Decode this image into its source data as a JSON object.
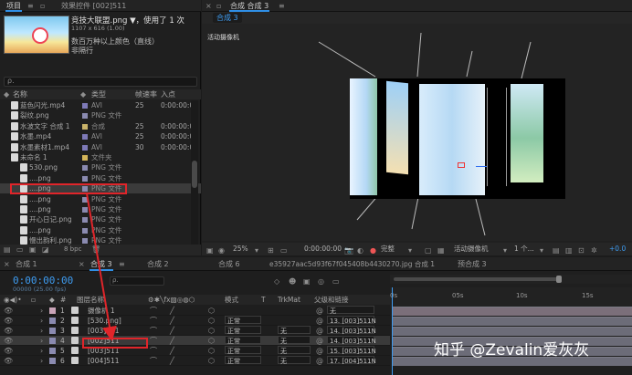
{
  "project_panel": {
    "tabs": [
      {
        "label": "项目"
      },
      {
        "label": "效果控件 [002]511"
      }
    ],
    "file": {
      "name": "竞技大联盟.png ▼",
      "used": "，使用了 1 次",
      "dims": "1107 x 616 (1.00)",
      "depth": "数百万种以上颜色（直线）",
      "interlace": "非隔行"
    },
    "thumb_text": "",
    "search_placeholder": "ρ.",
    "columns": {
      "name": "名称",
      "type": "类型",
      "fps": "帧速率",
      "in": "入点"
    },
    "rows": [
      {
        "name": "蓝色闪光.mp4",
        "type": "AVI",
        "fps": "25",
        "in": "0:00:00:0",
        "color": "#7e7ab8"
      },
      {
        "name": "裂纹.png",
        "type": "PNG 文件",
        "fps": "",
        "in": "",
        "color": "#8a8ab0"
      },
      {
        "name": "水波文字 合成 1",
        "type": "合成",
        "fps": "25",
        "in": "0:00:00:0",
        "color": "#c9b36a"
      },
      {
        "name": "水墨.mp4",
        "type": "AVI",
        "fps": "25",
        "in": "0:00:00:0",
        "color": "#7e7ab8"
      },
      {
        "name": "水墨素材1.mp4",
        "type": "AVI",
        "fps": "30",
        "in": "0:00:00:0",
        "color": "#7e7ab8"
      },
      {
        "name": "未命名 1",
        "type": "文件夹",
        "fps": "",
        "in": "",
        "color": "#d4b55a"
      },
      {
        "name": "530.png",
        "type": "PNG 文件",
        "fps": "",
        "in": "",
        "color": "#8a8ab0"
      },
      {
        "name": "....png",
        "type": "PNG 文件",
        "fps": "",
        "in": "",
        "color": "#8a8ab0"
      },
      {
        "name": "....png",
        "type": "PNG 文件",
        "fps": "",
        "in": "",
        "color": "#8a8ab0"
      },
      {
        "name": "....png",
        "type": "PNG 文件",
        "fps": "",
        "in": "",
        "color": "#8a8ab0"
      },
      {
        "name": "....png",
        "type": "PNG 文件",
        "fps": "",
        "in": "",
        "color": "#8a8ab0"
      },
      {
        "name": "开心日记.png",
        "type": "PNG 文件",
        "fps": "",
        "in": "",
        "color": "#8a8ab0"
      },
      {
        "name": "....png",
        "type": "PNG 文件",
        "fps": "",
        "in": "",
        "color": "#8a8ab0"
      },
      {
        "name": "慢出韵利.png",
        "type": "PNG 文件",
        "fps": "",
        "in": "",
        "color": "#8a8ab0"
      }
    ],
    "bpc": "8 bpc"
  },
  "viewer": {
    "tabs": [
      {
        "label": "合成 合成 3"
      }
    ],
    "subtab": "合成 3",
    "camera_label": "活动摄像机",
    "zoom": "25%",
    "timecode": "0:00:00:00",
    "quality": "完整",
    "view": "活动摄像机",
    "views_count": "1 个...",
    "exposure": "+0.0"
  },
  "timeline": {
    "tabs": [
      {
        "label": "合成 1"
      },
      {
        "label": "合成 3"
      },
      {
        "label": "合成 2"
      },
      {
        "label": "合成 6"
      },
      {
        "label": "e35927aac5d93f67f045408b4430270.jpg 合成 1"
      },
      {
        "label": "预合成 3"
      }
    ],
    "timecode": "0:00:00:00",
    "timecode_sub": "00000 (25.00 fps)",
    "search_placeholder": "ρ.",
    "columns": {
      "num": "#",
      "name": "图层名称",
      "mode": "模式",
      "trkmat": "TrkMat",
      "parent": "父级和链接"
    },
    "rows": [
      {
        "num": "1",
        "name": "摄像机 1",
        "mode": "",
        "trk": "",
        "parent": "无",
        "color": "#c9a4b8"
      },
      {
        "num": "2",
        "name": "[530.png]",
        "mode": "正常",
        "trk": "",
        "parent": "13. [003]511N",
        "color": "#8a8ab0"
      },
      {
        "num": "3",
        "name": "[003]511",
        "mode": "正常",
        "trk": "无",
        "parent": "14. [003]511N",
        "color": "#8a8ab0"
      },
      {
        "num": "4",
        "name": "[002]511",
        "mode": "正常",
        "trk": "无",
        "parent": "14. [003]511N",
        "color": "#8a8ab0"
      },
      {
        "num": "5",
        "name": "[003]511",
        "mode": "正常",
        "trk": "无",
        "parent": "15. [003]511N",
        "color": "#8a8ab0"
      },
      {
        "num": "6",
        "name": "[004]511",
        "mode": "正常",
        "trk": "无",
        "parent": "17. [004]511N",
        "color": "#8a8ab0"
      }
    ],
    "ruler": [
      "0s",
      "05s",
      "10s",
      "15s"
    ]
  },
  "watermark": "知乎 @Zevalin爱灰灰",
  "colors": {
    "accent": "#2f8fe6",
    "highlight": "#e0252a",
    "timecode": "#3e9cf1"
  }
}
